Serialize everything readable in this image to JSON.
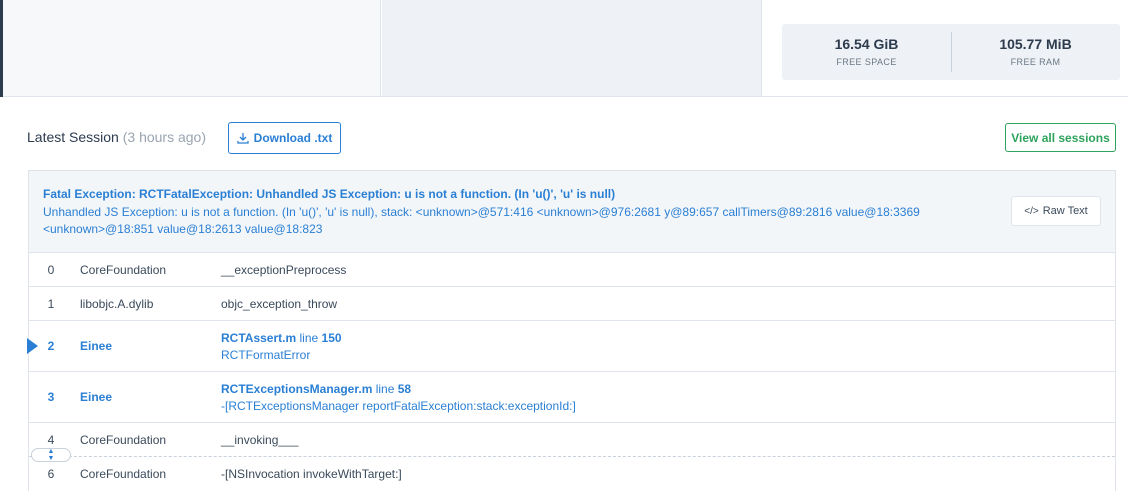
{
  "device": {
    "free_space": "16.54 GiB",
    "free_space_label": "FREE SPACE",
    "free_ram": "105.77 MiB",
    "free_ram_label": "FREE RAM"
  },
  "session": {
    "title": "Latest Session",
    "ago": "(3 hours ago)",
    "download_label": "Download .txt",
    "view_all_label": "View all sessions"
  },
  "exception": {
    "title": "Fatal Exception: RCTFatalException: Unhandled JS Exception: u is not a function. (In 'u()', 'u' is null)",
    "message": "Unhandled JS Exception: u is not a function. (In 'u()', 'u' is null), stack: <unknown>@571:416 <unknown>@976:2681 y@89:657 callTimers@89:2816 value@18:3369 <unknown>@18:851 value@18:2613 value@18:823",
    "raw_text_label": "Raw Text"
  },
  "frames": [
    {
      "index": "0",
      "library": "CoreFoundation",
      "symbol": "__exceptionPreprocess"
    },
    {
      "index": "1",
      "library": "libobjc.A.dylib",
      "symbol": "objc_exception_throw"
    },
    {
      "index": "2",
      "library": "Einee",
      "file": "RCTAssert.m",
      "line_label": "line",
      "line": "150",
      "symbol": "RCTFormatError"
    },
    {
      "index": "3",
      "library": "Einee",
      "file": "RCTExceptionsManager.m",
      "line_label": "line",
      "line": "58",
      "symbol": "-[RCTExceptionsManager reportFatalException:stack:exceptionId:]"
    },
    {
      "index": "4",
      "library": "CoreFoundation",
      "symbol": "__invoking___"
    },
    {
      "index": "6",
      "library": "CoreFoundation",
      "symbol": "-[NSInvocation invokeWithTarget:]"
    }
  ],
  "colors": {
    "accent_blue": "#2a7fd4",
    "accent_green": "#2ea35b",
    "dark_navy": "#2d3b4e"
  }
}
